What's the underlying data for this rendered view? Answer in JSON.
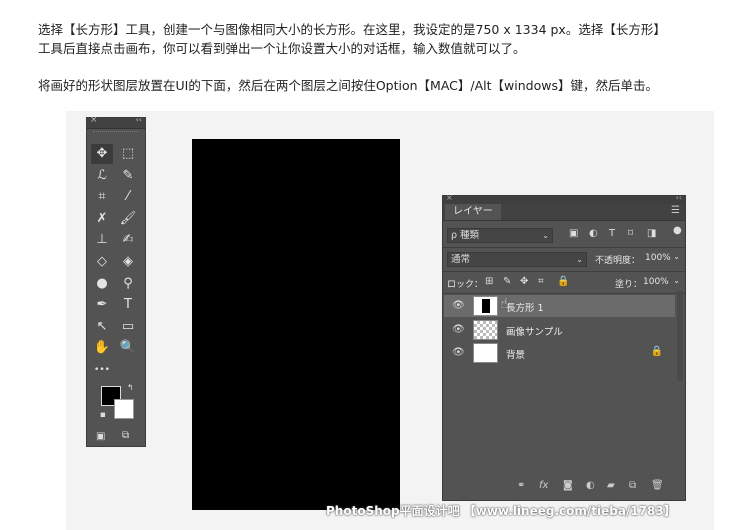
{
  "text": {
    "para1_line1": "选择【长方形】工具，创建一个与图像相同大小的长方形。在这里，我设定的是750 x 1334 px。选择【长方形】",
    "para1_line2": "工具后直接点击画布，你可以看到弹出一个让你设置大小的对话框，输入数值就可以了。",
    "para2": "将画好的形状图层放置在UI的下面，然后在两个图层之间按住Option【MAC】/Alt【windows】键，然后单击。"
  },
  "tools_panel": {
    "close": "×",
    "collapse": "‹‹",
    "tools": [
      {
        "icon": "move-icon",
        "glyph": "✥",
        "active": true
      },
      {
        "icon": "marquee-icon",
        "glyph": "⬚",
        "active": false
      },
      {
        "icon": "lasso-icon",
        "glyph": "ℒ",
        "active": false
      },
      {
        "icon": "quick-select-icon",
        "glyph": "✎",
        "active": false
      },
      {
        "icon": "crop-icon",
        "glyph": "⌗",
        "active": false
      },
      {
        "icon": "eyedropper-icon",
        "glyph": "⁄",
        "active": false
      },
      {
        "icon": "healing-icon",
        "glyph": "✗",
        "active": false
      },
      {
        "icon": "brush-icon",
        "glyph": "🖌",
        "active": false
      },
      {
        "icon": "stamp-icon",
        "glyph": "⊥",
        "active": false
      },
      {
        "icon": "history-brush-icon",
        "glyph": "✍",
        "active": false
      },
      {
        "icon": "eraser-icon",
        "glyph": "◇",
        "active": false
      },
      {
        "icon": "bucket-icon",
        "glyph": "◈",
        "active": false
      },
      {
        "icon": "blur-icon",
        "glyph": "●",
        "active": false
      },
      {
        "icon": "dodge-icon",
        "glyph": "⚲",
        "active": false
      },
      {
        "icon": "pen-icon",
        "glyph": "✒",
        "active": false
      },
      {
        "icon": "type-icon",
        "glyph": "T",
        "active": false
      },
      {
        "icon": "path-select-icon",
        "glyph": "↖",
        "active": false
      },
      {
        "icon": "rectangle-icon",
        "glyph": "▭",
        "active": false
      },
      {
        "icon": "hand-icon",
        "glyph": "✋",
        "active": false
      },
      {
        "icon": "zoom-icon",
        "glyph": "🔍",
        "active": false
      },
      {
        "icon": "more-icon",
        "glyph": "•••",
        "active": false
      }
    ]
  },
  "layers_panel": {
    "tab": "レイヤー",
    "filter_kind": "ρ 種類",
    "blend_mode": "通常",
    "opacity_label": "不透明度：",
    "opacity_value": "100%",
    "lock_label": "ロック：",
    "fill_label": "塗り：",
    "fill_value": "100%",
    "layers": [
      {
        "name": "長方形 1",
        "selected": true,
        "thumb": "shape",
        "locked": false
      },
      {
        "name": "画像サンプル",
        "selected": false,
        "thumb": "checker",
        "locked": false
      },
      {
        "name": "背景",
        "selected": false,
        "thumb": "white",
        "locked": true
      }
    ]
  },
  "watermark": "PhotoShop平面设计吧 【www.lineeg.com/tieba/1783】"
}
